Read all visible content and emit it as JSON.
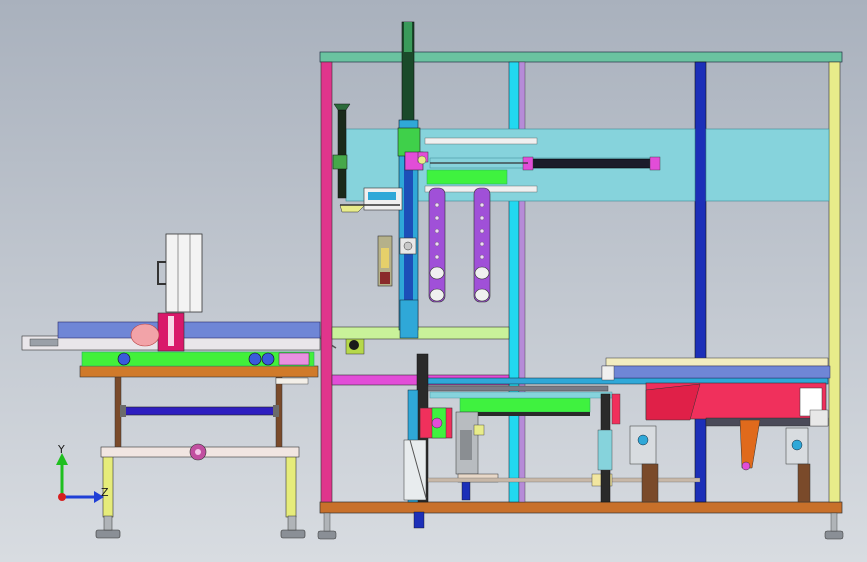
{
  "viewport": {
    "background_top": "#a9b1bd",
    "background_bottom": "#d8dce1"
  },
  "triad": {
    "y_label": "Y",
    "z_label": "Z",
    "y_color": "#1fbf1f",
    "z_color": "#1f3fd6",
    "x_color": "#d61f1f"
  },
  "palette": {
    "frame_magenta": "#e0358c",
    "frame_cyan": "#22d8f0",
    "frame_blue": "#1c2fb8",
    "frame_yellow": "#e8ec8a",
    "top_beam": "#6ac3a0",
    "base_beam": "#c8702a",
    "panel_cyan": "#86d3dc",
    "conveyor_blue": "#6f86d6",
    "green_rail": "#3ff23f",
    "red_plate": "#f0305c",
    "purple_part": "#a050d8"
  }
}
